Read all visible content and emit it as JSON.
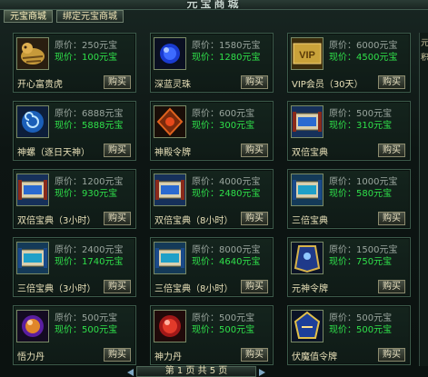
{
  "window": {
    "title": "元宝商城"
  },
  "tabs": [
    {
      "label": "元宝商城"
    },
    {
      "label": "绑定元宝商城"
    }
  ],
  "buy_label": "购买",
  "items": [
    {
      "icon": "golden-tiger-icon",
      "orig": "原价：250元宝",
      "now": "现价：100元宝",
      "name": "开心富贵虎"
    },
    {
      "icon": "blue-orb-icon",
      "orig": "原价：1580元宝",
      "now": "现价：1280元宝",
      "name": "深蓝灵珠"
    },
    {
      "icon": "vip-card-icon",
      "orig": "原价：6000元宝",
      "now": "现价：4500元宝",
      "name": "VIP会员（30天）"
    },
    {
      "icon": "spiral-shell-icon",
      "orig": "原价：6888元宝",
      "now": "现价：5888元宝",
      "name": "神螺（逐日天神）"
    },
    {
      "icon": "red-token-icon",
      "orig": "原价：600元宝",
      "now": "现价：300元宝",
      "name": "神殿令牌"
    },
    {
      "icon": "double-scroll-icon",
      "orig": "原价：500元宝",
      "now": "现价：310元宝",
      "name": "双倍宝典"
    },
    {
      "icon": "double-scroll-icon",
      "orig": "原价：1200元宝",
      "now": "现价：930元宝",
      "name": "双倍宝典（3小时）"
    },
    {
      "icon": "double-scroll-icon",
      "orig": "原价：4000元宝",
      "now": "现价：2480元宝",
      "name": "双倍宝典（8小时）"
    },
    {
      "icon": "triple-scroll-icon",
      "orig": "原价：1000元宝",
      "now": "现价：580元宝",
      "name": "三倍宝典"
    },
    {
      "icon": "triple-scroll-icon",
      "orig": "原价：2400元宝",
      "now": "现价：1740元宝",
      "name": "三倍宝典（3小时）"
    },
    {
      "icon": "triple-scroll-icon",
      "orig": "原价：8000元宝",
      "now": "现价：4640元宝",
      "name": "三倍宝典（8小时）"
    },
    {
      "icon": "spirit-token-icon",
      "orig": "原价：1500元宝",
      "now": "现价：750元宝",
      "name": "元神令牌"
    },
    {
      "icon": "purple-pill-icon",
      "orig": "原价：500元宝",
      "now": "现价：500元宝",
      "name": "悟力丹"
    },
    {
      "icon": "red-pill-icon",
      "orig": "原价：500元宝",
      "now": "现价：500元宝",
      "name": "神力丹"
    },
    {
      "icon": "demon-token-icon",
      "orig": "原价：500元宝",
      "now": "现价：500元宝",
      "name": "伏魔值令牌"
    }
  ],
  "pager": {
    "text": "第 1 页 共 5 页"
  },
  "side": {
    "chars": [
      "元",
      "积"
    ]
  }
}
